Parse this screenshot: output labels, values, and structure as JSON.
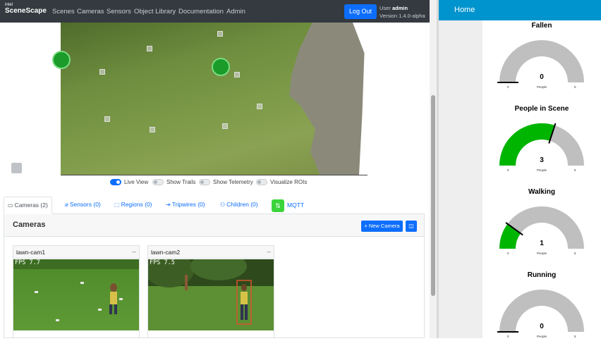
{
  "app": {
    "brand_top": "intel",
    "brand_name": "SceneScape",
    "nav": [
      "Scenes",
      "Cameras",
      "Sensors",
      "Object Library",
      "Documentation",
      "Admin"
    ],
    "logout_label": "Log Out",
    "user_label": "User",
    "user_name": "admin",
    "version": "Version 1.4.0-alpha"
  },
  "view_toggles": [
    {
      "label": "Live View",
      "on": true
    },
    {
      "label": "Show Trails",
      "on": false
    },
    {
      "label": "Show Telemetry",
      "on": false
    },
    {
      "label": "Visualize ROIs",
      "on": false
    }
  ],
  "tabs": [
    {
      "label": "Cameras (2)",
      "icon": "camera-icon"
    },
    {
      "label": "Sensors (0)",
      "icon": "sensor-icon"
    },
    {
      "label": "Regions (0)",
      "icon": "regions-icon"
    },
    {
      "label": "Tripwires (0)",
      "icon": "tripwire-icon"
    },
    {
      "label": "Children (0)",
      "icon": "children-icon"
    },
    {
      "label": "MQTT",
      "icon": "mqtt-icon"
    }
  ],
  "cameras_panel": {
    "title": "Cameras",
    "new_camera_label": "+ New Camera",
    "cards": [
      {
        "name": "lawn-cam1",
        "status": "--",
        "fps": "FPS 7.7"
      },
      {
        "name": "lawn-cam2",
        "status": "--",
        "fps": "FPS 7.5"
      }
    ]
  },
  "dashboard": {
    "title": "Home",
    "gauges": [
      {
        "title": "Fallen",
        "value": 0,
        "unit": "People",
        "min": 0,
        "max": 5,
        "color": "#00b500"
      },
      {
        "title": "People in Scene",
        "value": 3,
        "unit": "People",
        "min": 0,
        "max": 5,
        "color": "#00b500"
      },
      {
        "title": "Walking",
        "value": 1,
        "unit": "People",
        "min": 0,
        "max": 5,
        "color": "#00b500"
      },
      {
        "title": "Running",
        "value": 0,
        "unit": "People",
        "min": 0,
        "max": 5,
        "color": "#00b500"
      }
    ]
  },
  "colors": {
    "accent": "#0d6efd",
    "navbar": "#343a40",
    "dashboard_header": "#0094ce",
    "gauge_track": "#bfbfbf"
  }
}
